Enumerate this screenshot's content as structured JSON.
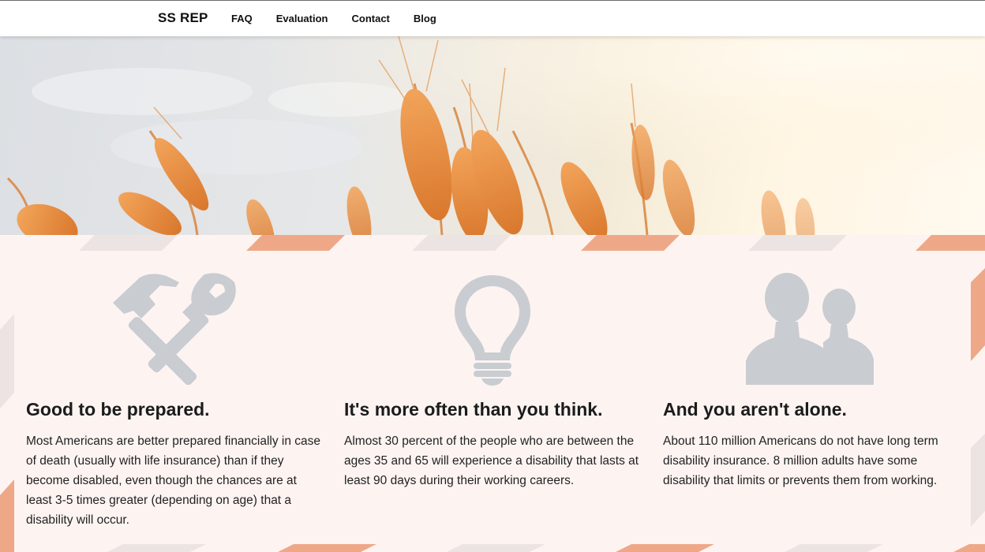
{
  "nav": {
    "brand": "SS REP",
    "links": [
      "FAQ",
      "Evaluation",
      "Contact",
      "Blog"
    ]
  },
  "features": [
    {
      "icon": "hammer-wrench-icon",
      "title": "Good to be prepared.",
      "body": "Most Americans are better prepared financially in case of death (usually with life insurance) than if they become disabled, even though the chances are at least 3-5 times greater (depending on age) that a disability will occur."
    },
    {
      "icon": "lightbulb-icon",
      "title": "It's more often than you think.",
      "body": "Almost 30 percent of the people who are between the ages 35 and 65 will experience a disability that lasts at least 90 days during their working careers."
    },
    {
      "icon": "users-icon",
      "title": "And you aren't alone.",
      "body": "About 110 million Americans do not have long term disability insurance. 8 million adults have some disability that limits or prevents them from working."
    }
  ],
  "colors": {
    "accent_stripe": "#eea888",
    "light_stripe": "#ece4e2",
    "icon_gray": "#c9ccd1",
    "panel_bg": "#fdf4f2"
  }
}
